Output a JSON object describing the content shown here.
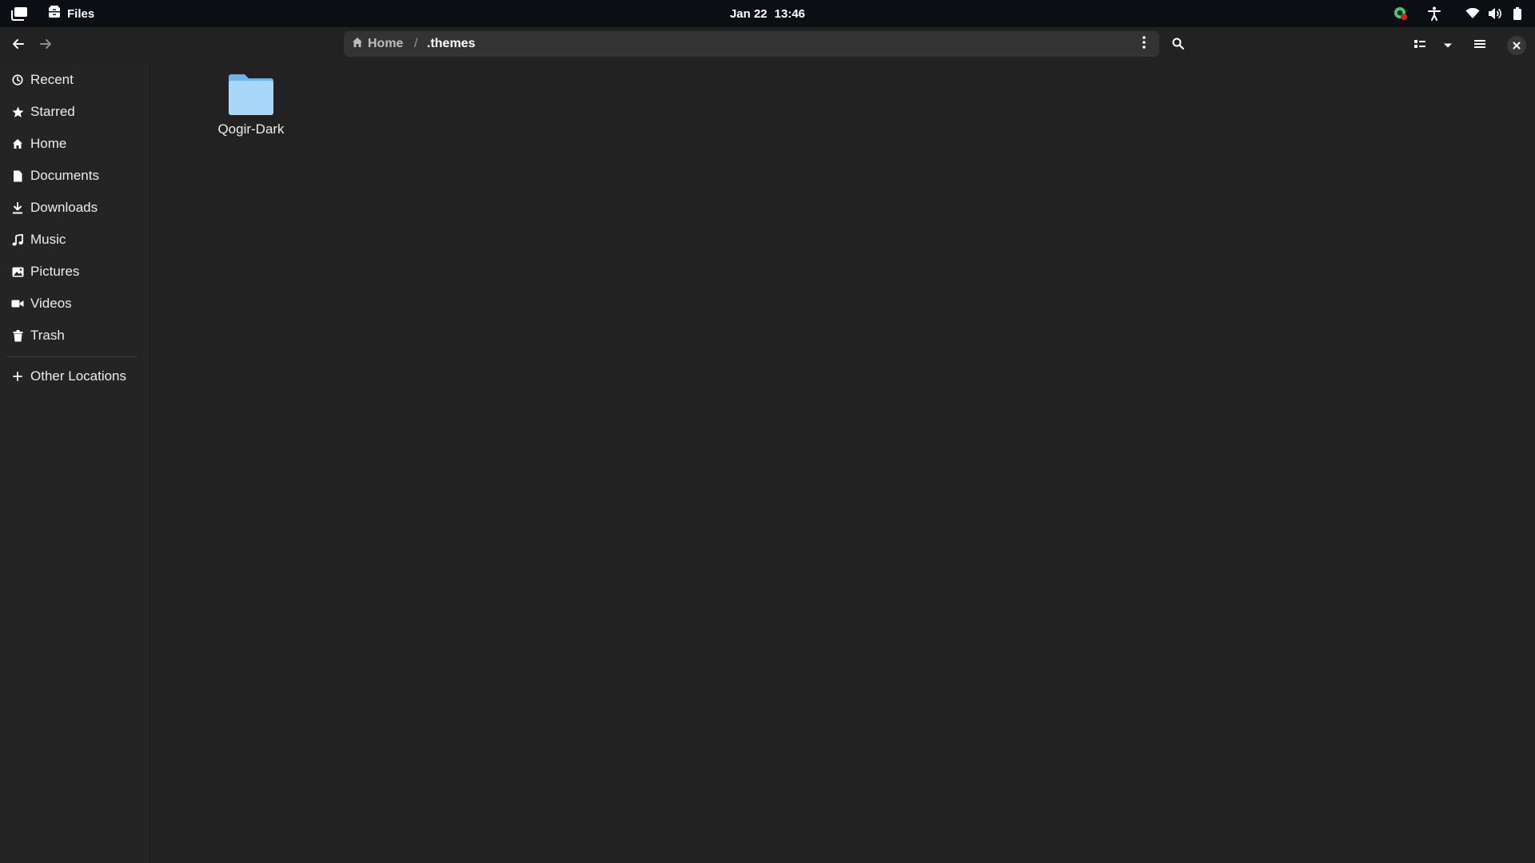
{
  "topbar": {
    "activities_icon": "activities-icon",
    "app_icon": "files-cabinet-icon",
    "app_name": "Files",
    "date": "Jan 22",
    "time": "13:46",
    "tray_icons": [
      "update-notifier-icon",
      "accessibility-icon",
      "wifi-icon",
      "volume-icon",
      "battery-icon"
    ],
    "update_badge_color": "#e01b24",
    "update_icon_color": "#33d17a"
  },
  "headerbar": {
    "back_icon": "arrow-left-icon",
    "forward_icon": "arrow-right-icon",
    "path": {
      "home_label": "Home",
      "separator": "/",
      "current_label": ".themes",
      "menu_icon": "vertical-ellipsis-icon"
    },
    "search_icon": "search-icon",
    "view_toggle_icon": "list-view-icon",
    "view_options_icon": "chevron-down-icon",
    "main_menu_icon": "hamburger-menu-icon",
    "close_icon": "close-icon"
  },
  "sidebar": {
    "items": [
      {
        "label": "Recent",
        "icon": "clock-icon"
      },
      {
        "label": "Starred",
        "icon": "star-icon"
      },
      {
        "label": "Home",
        "icon": "home-icon"
      },
      {
        "label": "Documents",
        "icon": "document-icon"
      },
      {
        "label": "Downloads",
        "icon": "download-icon"
      },
      {
        "label": "Music",
        "icon": "music-note-icon"
      },
      {
        "label": "Pictures",
        "icon": "picture-icon"
      },
      {
        "label": "Videos",
        "icon": "video-camera-icon"
      },
      {
        "label": "Trash",
        "icon": "trash-icon"
      }
    ],
    "other_locations": {
      "label": "Other Locations",
      "icon": "plus-icon"
    }
  },
  "content": {
    "files": [
      {
        "name": "Qogir-Dark",
        "icon": "folder-icon",
        "color": "#a8d8f8"
      }
    ]
  },
  "colors": {
    "topbar_bg": "#0b0e13",
    "window_bg": "#222222",
    "pathbar_bg": "#333333",
    "folder_light": "#a8d8f8",
    "folder_tab": "#6cb4ea"
  }
}
